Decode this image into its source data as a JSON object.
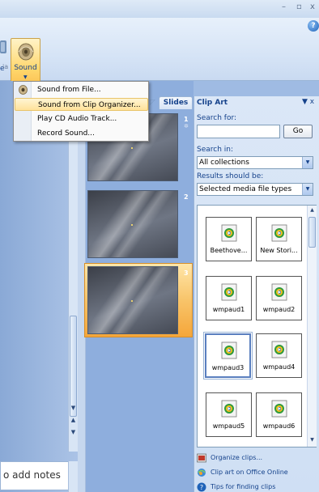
{
  "window": {
    "min": "–",
    "max": "▫",
    "close": "x",
    "help": "?"
  },
  "ribbon": {
    "partial_label": "e",
    "partial_label_2": "ia",
    "sound_button": {
      "label": "Sound",
      "icon": "speaker-icon"
    }
  },
  "sound_menu": {
    "items": [
      {
        "label": "Sound from File...",
        "icon": "speaker-icon"
      },
      {
        "label": "Sound from Clip Organizer...",
        "highlighted": true
      },
      {
        "label": "Play CD Audio Track..."
      },
      {
        "label": "Record Sound..."
      }
    ]
  },
  "slides_pane": {
    "tab_label": "Slides",
    "slides": [
      {
        "number": "1"
      },
      {
        "number": "2"
      },
      {
        "number": "3",
        "selected": true
      }
    ]
  },
  "notes": {
    "placeholder_text": "o add notes"
  },
  "clip_art": {
    "title": "Clip Art",
    "title_controls": "▼ x",
    "search_for_label": "Search for:",
    "search_value": "",
    "go_label": "Go",
    "search_in_label": "Search in:",
    "search_in_value": "All collections",
    "results_label": "Results should be:",
    "results_value": "Selected media file types",
    "items": [
      {
        "label": "Beethove..."
      },
      {
        "label": "New Stori..."
      },
      {
        "label": "wmpaud1"
      },
      {
        "label": "wmpaud2"
      },
      {
        "label": "wmpaud3",
        "selected": true
      },
      {
        "label": "wmpaud4"
      },
      {
        "label": "wmpaud5"
      },
      {
        "label": "wmpaud6"
      }
    ],
    "links": [
      {
        "label": "Organize clips...",
        "icon": "organize-icon"
      },
      {
        "label": "Clip art on Office Online",
        "icon": "office-online-icon"
      },
      {
        "label": "Tips for finding clips",
        "icon": "help-icon"
      }
    ]
  },
  "colors": {
    "ribbon_bg": "#d6e4f6",
    "accent_orange": "#f8c46a",
    "title_blue": "#15428b"
  }
}
